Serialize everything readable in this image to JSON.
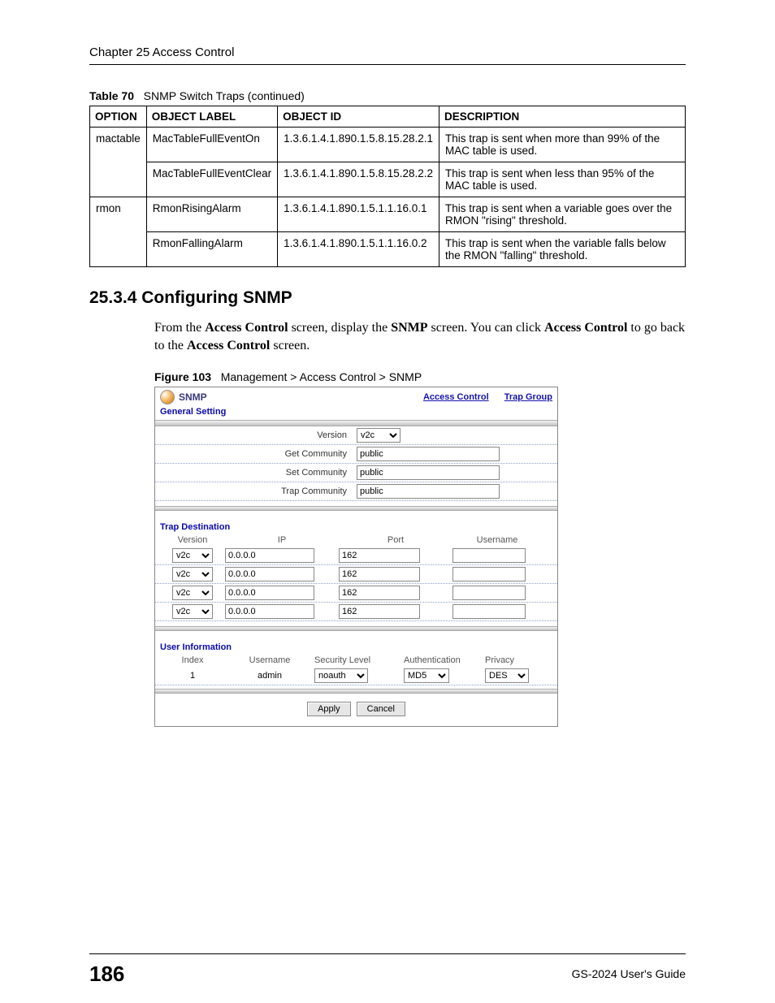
{
  "chapter_header": "Chapter 25 Access Control",
  "table_caption_prefix": "Table 70",
  "table_caption_text": "SNMP Switch Traps  (continued)",
  "table_headers": {
    "option": "OPTION",
    "object_label": "OBJECT LABEL",
    "object_id": "OBJECT ID",
    "description": "DESCRIPTION"
  },
  "trap_rows": [
    {
      "option": "mactable",
      "label": "MacTableFullEventOn",
      "oid": "1.3.6.1.4.1.890.1.5.8.15.28.2.1",
      "desc": "This trap is sent when more than 99% of the MAC table is used."
    },
    {
      "option": "",
      "label": "MacTableFullEventClear",
      "oid": "1.3.6.1.4.1.890.1.5.8.15.28.2.2",
      "desc": "This trap is sent when less than 95% of the MAC table is used."
    },
    {
      "option": "rmon",
      "label": "RmonRisingAlarm",
      "oid": "1.3.6.1.4.1.890.1.5.1.1.16.0.1",
      "desc": "This trap is sent when a variable goes over the RMON \"rising\" threshold."
    },
    {
      "option": "",
      "label": "RmonFallingAlarm",
      "oid": "1.3.6.1.4.1.890.1.5.1.1.16.0.2",
      "desc": "This trap is sent when the variable falls below the RMON \"falling\" threshold."
    }
  ],
  "section_heading": "25.3.4  Configuring SNMP",
  "body_parts": {
    "p1a": "From the ",
    "p1b": "Access Control",
    "p1c": " screen, display the ",
    "p1d": "SNMP",
    "p1e": " screen. You can click ",
    "p1f": "Access Control",
    "p1g": " to go back to the ",
    "p1h": "Access Control",
    "p1i": " screen."
  },
  "figure_caption_prefix": "Figure 103",
  "figure_caption_text": "Management > Access Control > SNMP",
  "snmp": {
    "title": "SNMP",
    "link_access_control": "Access Control",
    "link_trap_group": "Trap Group",
    "general_setting": "General Setting",
    "labels": {
      "version": "Version",
      "get": "Get Community",
      "set": "Set Community",
      "trap": "Trap Community"
    },
    "values": {
      "version": "v2c",
      "get": "public",
      "set": "public",
      "trap": "public"
    },
    "trap_destination": {
      "title": "Trap Destination",
      "headers": {
        "version": "Version",
        "ip": "IP",
        "port": "Port",
        "username": "Username"
      },
      "rows": [
        {
          "version": "v2c",
          "ip": "0.0.0.0",
          "port": "162",
          "username": ""
        },
        {
          "version": "v2c",
          "ip": "0.0.0.0",
          "port": "162",
          "username": ""
        },
        {
          "version": "v2c",
          "ip": "0.0.0.0",
          "port": "162",
          "username": ""
        },
        {
          "version": "v2c",
          "ip": "0.0.0.0",
          "port": "162",
          "username": ""
        }
      ]
    },
    "user_info": {
      "title": "User Information",
      "headers": {
        "index": "Index",
        "username": "Username",
        "seclevel": "Security Level",
        "auth": "Authentication",
        "priv": "Privacy"
      },
      "rows": [
        {
          "index": "1",
          "username": "admin",
          "seclevel": "noauth",
          "auth": "MD5",
          "priv": "DES"
        }
      ]
    },
    "buttons": {
      "apply": "Apply",
      "cancel": "Cancel"
    }
  },
  "page_number": "186",
  "guide_title": "GS-2024 User's Guide"
}
